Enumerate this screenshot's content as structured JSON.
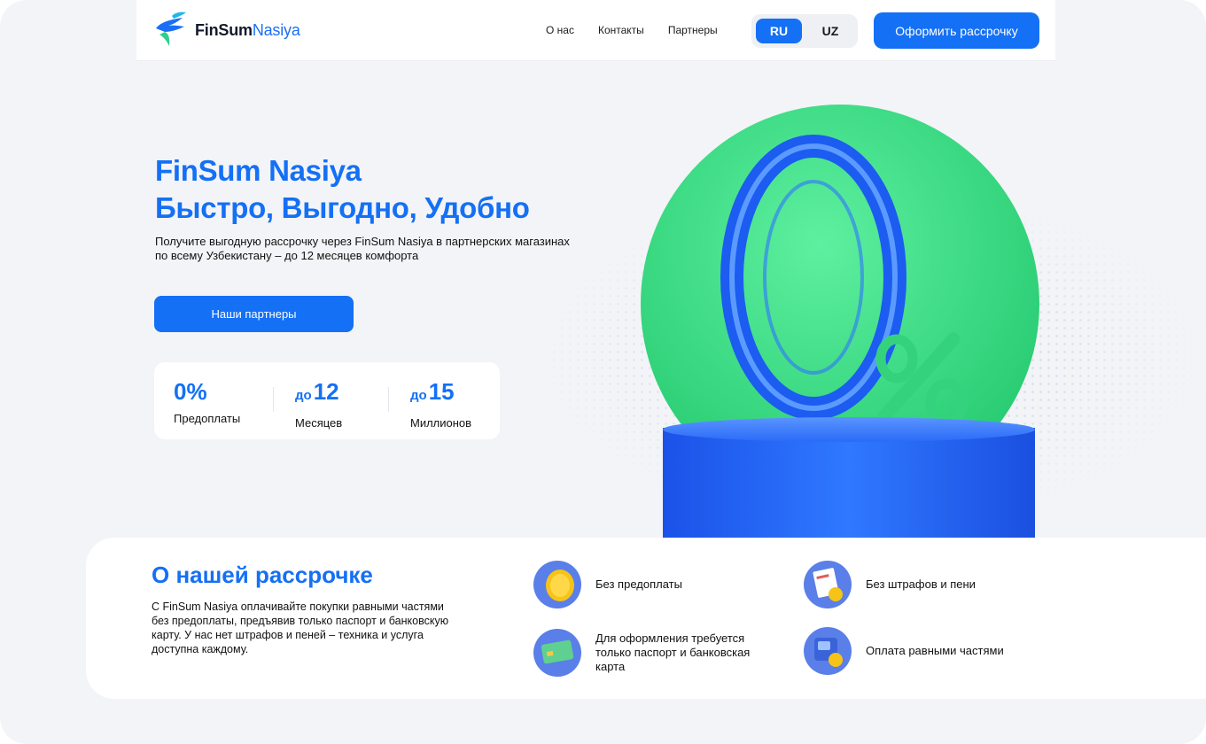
{
  "brand": {
    "name_part1": "FinSum",
    "name_part2": "Nasiya"
  },
  "nav": {
    "items": [
      {
        "label": "О нас"
      },
      {
        "label": "Контакты"
      },
      {
        "label": "Партнеры"
      }
    ]
  },
  "language": {
    "ru": "RU",
    "uz": "UZ",
    "selected": "RU"
  },
  "header": {
    "cta_label": "Оформить рассрочку"
  },
  "hero": {
    "title_line1": "FinSum Nasiya",
    "title_line2": "Быстро, Выгодно, Удобно",
    "description": "Получите выгодную рассрочку через FinSum Nasiya в партнерских магазинах по всему Узбекистану – до 12 месяцев комфорта",
    "button_label": "Наши партнеры",
    "illustration_text": "0%"
  },
  "stats": [
    {
      "prefix": "",
      "value": "0%",
      "label": "Предоплаты"
    },
    {
      "prefix": "до",
      "value": "12",
      "label": "Месяцев"
    },
    {
      "prefix": "до",
      "value": "15",
      "label": "Миллионов"
    }
  ],
  "about": {
    "title": "О нашей рассрочке",
    "text": "С FinSum Nasiya оплачивайте покупки равными частями без предоплаты, предъявив только паспорт и банковскую карту. У нас нет штрафов и пеней – техника и услуга доступна каждому.",
    "features": [
      {
        "icon": "coin-icon",
        "label": "Без предоплаты"
      },
      {
        "icon": "invoice-icon",
        "label": "Без штрафов и пени"
      },
      {
        "icon": "card-icon",
        "label": "Для оформления требуется только паспорт и банковская карта"
      },
      {
        "icon": "wallet-icon",
        "label": "Оплата равными частями"
      }
    ]
  },
  "colors": {
    "brand_blue": "#1470f5",
    "brand_green": "#3ddc84",
    "background": "#f3f4f7"
  }
}
